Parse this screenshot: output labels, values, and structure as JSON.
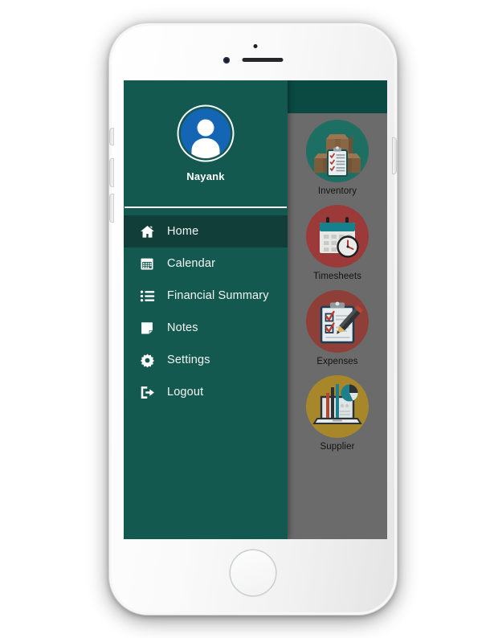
{
  "device": {
    "type": "smartphone-mockup",
    "earpiece": "earpiece-speaker",
    "front_camera": "front-camera-icon",
    "proximity_sensor": "proximity-sensor-icon",
    "home_button": "home-button"
  },
  "colors": {
    "drawer_bg": "#14594f",
    "drawer_active": "#123e39",
    "app_bar": "#0a4a42",
    "content_bg": "#6b6b6b",
    "avatar_bg": "#1565b5",
    "divider": "#ffffff",
    "inventory_circle": "#1d6f64",
    "timesheets_circle": "#9c3a3a",
    "expenses_circle": "#8e4038",
    "supplier_circle": "#a8862a",
    "label_text": "#131313",
    "menu_text": "#f2f5f4"
  },
  "app_bar": {
    "title": ""
  },
  "drawer": {
    "username": "Nayank",
    "avatar_icon": "user-avatar-icon",
    "items": [
      {
        "label": "Home",
        "icon": "home-icon",
        "active": true
      },
      {
        "label": "Calendar",
        "icon": "calendar-icon",
        "active": false
      },
      {
        "label": "Financial Summary",
        "icon": "list-icon",
        "active": false
      },
      {
        "label": "Notes",
        "icon": "note-icon",
        "active": false
      },
      {
        "label": "Settings",
        "icon": "gear-icon",
        "active": false
      },
      {
        "label": "Logout",
        "icon": "logout-icon",
        "active": false
      }
    ]
  },
  "shortcuts": [
    {
      "label": "Inventory",
      "icon": "boxes-clipboard-icon",
      "circle_color": "#1d6f64"
    },
    {
      "label": "Timesheets",
      "icon": "calendar-clock-icon",
      "circle_color": "#9c3a3a"
    },
    {
      "label": "Expenses",
      "icon": "clipboard-pencil-icon",
      "circle_color": "#8e4038"
    },
    {
      "label": "Supplier",
      "icon": "laptop-charts-icon",
      "circle_color": "#a8862a"
    }
  ]
}
